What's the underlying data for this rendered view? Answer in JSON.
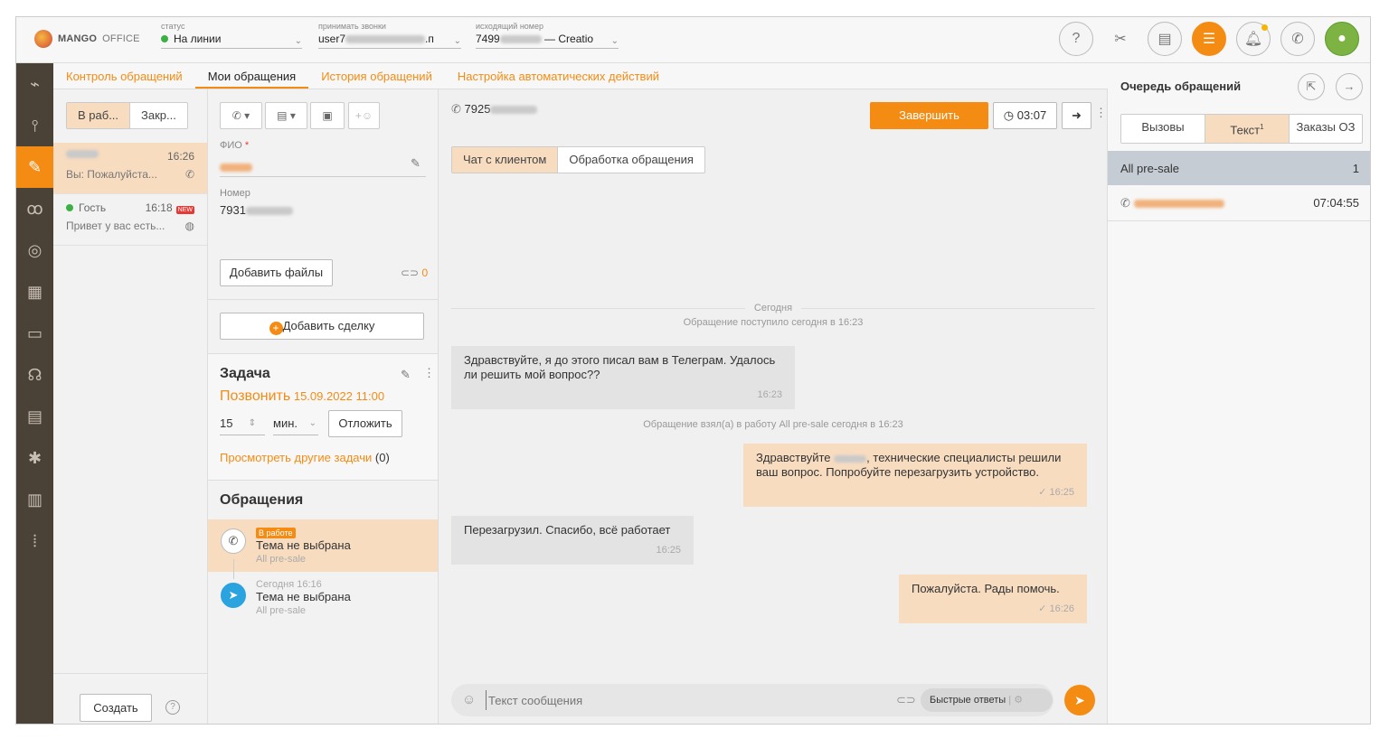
{
  "header": {
    "logo_brand": "MANGO",
    "logo_office": "OFFICE",
    "status_caption": "статус",
    "status_value": "На линии",
    "accept_caption": "принимать звонки",
    "accept_value_prefix": "user7",
    "accept_value_suffix": ".п",
    "outgoing_caption": "исходящий номер",
    "outgoing_prefix": "7499",
    "outgoing_suffix": "— Creatio",
    "icons": [
      "help-icon",
      "scissors-icon",
      "clipboard-icon",
      "queue-icon",
      "bell-icon",
      "phone-icon",
      "user-icon"
    ]
  },
  "tabs": [
    "Контроль обращений",
    "Мои обращения",
    "История обращений",
    "Настройка автоматических действий"
  ],
  "col1": {
    "seg": [
      "В раб...",
      "Закр..."
    ],
    "conversations": [
      {
        "time": "16:26",
        "preview": "Вы: Пожалуйста...",
        "channel": "whatsapp"
      },
      {
        "name": "Гость",
        "time": "16:18",
        "badge": "NEW",
        "preview": "Привет у вас есть...",
        "channel": "web"
      }
    ],
    "create_label": "Создать"
  },
  "col2": {
    "fio_label": "ФИО",
    "phone_label": "Номер",
    "phone_prefix": "7931",
    "add_files": "Добавить файлы",
    "attach_count": "0",
    "add_deal": "Добавить сделку",
    "task_title": "Задача",
    "task_action": "Позвонить",
    "task_date": "15.09.2022 11:00",
    "delay_value": "15",
    "delay_unit": "мин.",
    "postpone": "Отложить",
    "other_tasks": "Просмотреть другие задачи",
    "other_tasks_count": "(0)",
    "appeals_title": "Обращения",
    "appeals": [
      {
        "badge": "В работе",
        "title": "Тема не выбрана",
        "group": "All pre-sale"
      },
      {
        "date": "Сегодня 16:16",
        "title": "Тема не выбрана",
        "group": "All pre-sale"
      }
    ]
  },
  "chat": {
    "phone_prefix": "7925",
    "finish": "Завершить",
    "timer": "03:07",
    "tab_chat": "Чат с клиентом",
    "tab_process": "Обработка обращения",
    "today": "Сегодня",
    "received": "Обращение поступило сегодня в 16:23",
    "taken": "Обращение взял(а) в работу All pre-sale сегодня в 16:23",
    "messages": [
      {
        "dir": "in",
        "text": "Здравствуйте, я до этого писал вам в Телеграм. Удалось ли решить мой вопрос??",
        "time": "16:23"
      },
      {
        "dir": "out",
        "text_a": "Здравствуйте",
        "text_b": ", технические специалисты решили ваш вопрос. Попробуйте перезагрузить устройство.",
        "time": "16:25"
      },
      {
        "dir": "in",
        "text": "Перезагрузил. Спасибо, всё работает",
        "time": "16:25"
      },
      {
        "dir": "out",
        "text": "Пожалуйста. Рады помочь.",
        "time": "16:26"
      }
    ],
    "input_placeholder": "Текст сообщения",
    "quick_answers": "Быстрые ответы"
  },
  "queue": {
    "title": "Очередь обращений",
    "tabs": [
      "Вызовы",
      "Текст",
      "Заказы ОЗ"
    ],
    "text_badge": "1",
    "group": "All pre-sale",
    "group_count": "1",
    "item_time": "07:04:55"
  },
  "colors": {
    "accent": "#f48c14",
    "highlight": "#f8dcc0",
    "rail": "#4a4137"
  }
}
